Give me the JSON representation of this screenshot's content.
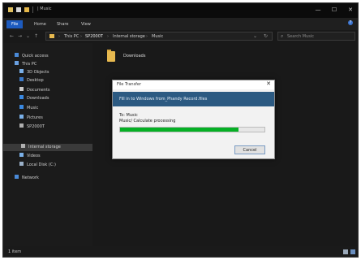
{
  "window": {
    "title": "| Music",
    "controls": [
      "—",
      "☐",
      "✕"
    ]
  },
  "ribbon": {
    "tabs": [
      "File",
      "Home",
      "Share",
      "View"
    ],
    "help": "?"
  },
  "address": {
    "nav": [
      "←",
      "→",
      "⌄",
      "↑"
    ],
    "crumbs": [
      "This PC",
      "SP2000T",
      "Internal storage",
      "Music"
    ],
    "separator": "›",
    "chevron": "⌄",
    "refresh": "↻",
    "search_placeholder": "Search Music"
  },
  "navpane": {
    "items": [
      {
        "label": "Quick access",
        "icon": "star-icon",
        "color": "#4a8ad8"
      },
      {
        "label": "This PC",
        "icon": "computer-icon",
        "color": "#6aa0e0"
      },
      {
        "label": "3D Objects",
        "icon": "cube-icon",
        "color": "#7ab0e8"
      },
      {
        "label": "Desktop",
        "icon": "desktop-icon",
        "color": "#3a78c8"
      },
      {
        "label": "Documents",
        "icon": "document-icon",
        "color": "#c8c8c8"
      },
      {
        "label": "Downloads",
        "icon": "download-icon",
        "color": "#3a88e0"
      },
      {
        "label": "Music",
        "icon": "music-icon",
        "color": "#3a88e0"
      },
      {
        "label": "Pictures",
        "icon": "picture-icon",
        "color": "#7ab0e8"
      },
      {
        "label": "SP2000T",
        "icon": "phone-icon",
        "color": "#b0b0b0"
      },
      {
        "label": "Internal storage",
        "icon": "drive-icon",
        "color": "#b0b0b0"
      },
      {
        "label": "Videos",
        "icon": "video-icon",
        "color": "#7ab0e8"
      },
      {
        "label": "Local Disk (C:)",
        "icon": "disk-icon",
        "color": "#9ab0c8"
      },
      {
        "label": "Network",
        "icon": "network-icon",
        "color": "#4a8ad8"
      }
    ]
  },
  "content": {
    "folder_name": "Downloads"
  },
  "status": {
    "text": "1 item"
  },
  "dialog": {
    "title": "File Transfer",
    "close": "✕",
    "header": "Fill in to Windows from_Phandy Record.files",
    "from_label": "To: Music",
    "status_line": "Music/ Calculate processing",
    "progress": 0.82,
    "cancel_label": "Cancel"
  },
  "colors": {
    "accent": "#1d5bbf",
    "progress": "#06b025",
    "folder": "#e7b94f",
    "dialog_header": "#2c5a82"
  }
}
